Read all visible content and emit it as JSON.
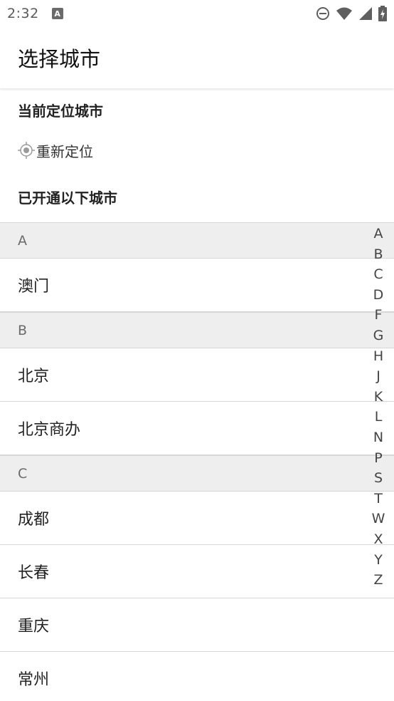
{
  "status_bar": {
    "time": "2:32",
    "app_icon_glyph": "A"
  },
  "header": {
    "title": "选择城市"
  },
  "location": {
    "current_heading": "当前定位城市",
    "relocate_label": "重新定位",
    "opened_heading": "已开通以下城市"
  },
  "groups": [
    {
      "letter": "A",
      "cities": [
        "澳门"
      ]
    },
    {
      "letter": "B",
      "cities": [
        "北京",
        "北京商办"
      ]
    },
    {
      "letter": "C",
      "cities": [
        "成都",
        "长春",
        "重庆",
        "常州"
      ]
    }
  ],
  "index_letters": [
    "A",
    "B",
    "C",
    "D",
    "F",
    "G",
    "H",
    "J",
    "K",
    "L",
    "N",
    "P",
    "S",
    "T",
    "W",
    "X",
    "Y",
    "Z"
  ],
  "colors": {
    "header_bg": "#eeeeee",
    "divider": "#d6d6d6",
    "text": "#222222"
  }
}
